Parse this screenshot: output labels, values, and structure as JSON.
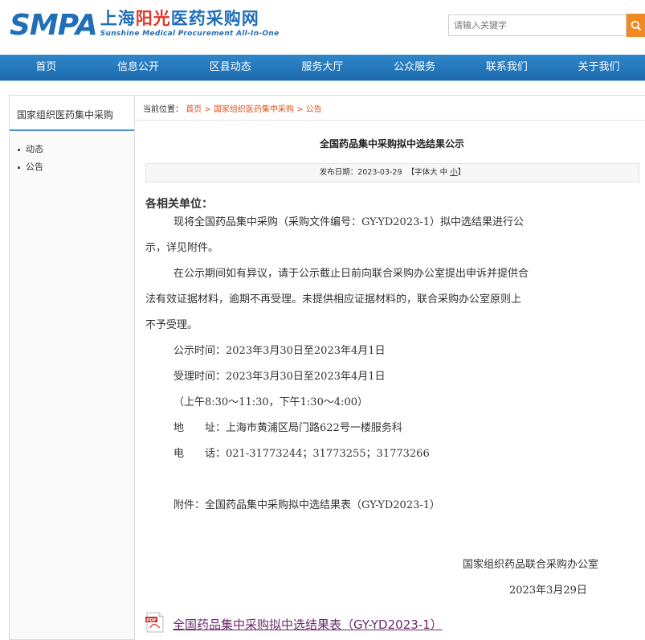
{
  "header": {
    "logo_mark": "SMPA",
    "logo_cn_prefix": "上海",
    "logo_cn_highlight": "阳光",
    "logo_cn_suffix": "医药采购网",
    "logo_en": "Sunshine Medical Procurement All-In-One",
    "search_placeholder": "请输入关键字"
  },
  "nav": [
    "首页",
    "信息公开",
    "区县动态",
    "服务大厅",
    "公众服务",
    "联系我们",
    "关于我们"
  ],
  "sidebar": {
    "title": "国家组织医药集中采购",
    "items": [
      "动态",
      "公告"
    ]
  },
  "breadcrumb": {
    "label": "当前位置：",
    "items": [
      "首页",
      "国家组织医药集中采购",
      "公告"
    ],
    "separator": " > "
  },
  "article": {
    "title": "全国药品集中采购拟中选结果公示",
    "date_label": "发布日期：",
    "date": "2023-03-29",
    "font_label": "【字体",
    "font_sizes": [
      "大",
      "中",
      "小"
    ],
    "font_close": "】",
    "salutation": "各相关单位：",
    "lines": [
      "现将全国药品集中采购（采购文件编号：GY-YD2023-1）拟中选结果进行公",
      "示，详见附件。",
      "在公示期间如有异议，请于公示截止日前向联合采购办公室提出申诉并提供合",
      "法有效证据材料，逾期不再受理。未提供相应证据材料的，联合采购办公室原则上",
      "不予受理。",
      "公示时间：2023年3月30日至2023年4月1日",
      "受理时间：2023年3月30日至2023年4月1日",
      "（上午8:30～11:30，下午1:30～4:00）",
      "地　　址：上海市黄浦区局门路622号一楼服务科",
      "电　　话：021-31773244；31773255；31773266",
      "附件：全国药品集中采购拟中选结果表（GY-YD2023-1）"
    ],
    "signature": "国家组织药品联合采购办公室",
    "sign_date": "2023年3月29日",
    "attachment_link": "全国药品集中采购拟中选结果表（GY-YD2023-1）",
    "pdf_badge": "PDF"
  },
  "colors": {
    "brand_blue": "#1f6fb8",
    "nav_blue": "#2478bd",
    "accent_orange": "#f08a24",
    "link_orange": "#d9541e"
  }
}
